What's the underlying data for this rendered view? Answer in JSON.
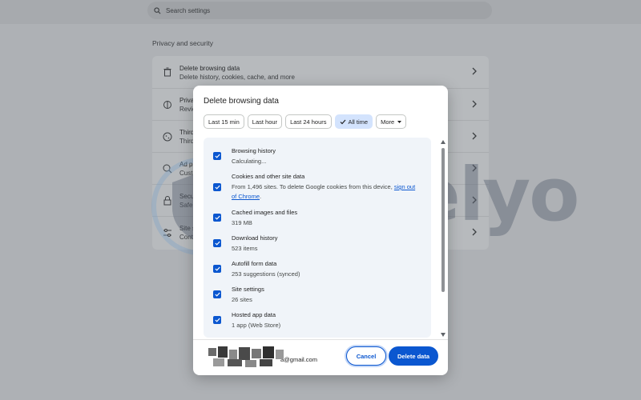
{
  "background": {
    "search_placeholder": "Search settings",
    "section_title": "Privacy and security",
    "rows": [
      {
        "title": "Delete browsing data",
        "subtitle": "Delete history, cookies, cache, and more",
        "icon": "trash-icon"
      },
      {
        "title": "Priva",
        "subtitle": "Revie",
        "icon": "privacy-guide-icon"
      },
      {
        "title": "Third",
        "subtitle": "Third",
        "icon": "cookie-icon"
      },
      {
        "title": "Ad p",
        "subtitle": "Custo",
        "icon": "ad-privacy-icon"
      },
      {
        "title": "Secu",
        "subtitle": "Safe",
        "icon": "lock-icon"
      },
      {
        "title": "Site s",
        "subtitle": "Cont",
        "icon": "tune-icon"
      }
    ]
  },
  "watermark": {
    "text": "Safelyo"
  },
  "dialog": {
    "title": "Delete browsing data",
    "time_ranges": [
      {
        "label": "Last 15 min",
        "selected": false
      },
      {
        "label": "Last hour",
        "selected": false
      },
      {
        "label": "Last 24 hours",
        "selected": false
      },
      {
        "label": "All time",
        "selected": true
      },
      {
        "label": "More",
        "selected": false
      }
    ],
    "items": [
      {
        "label": "Browsing history",
        "detail": "Calculating...",
        "checked": true
      },
      {
        "label": "Cookies and other site data",
        "detail": "From 1,496 sites. To delete Google cookies from this device, ",
        "link": "sign out of Chrome",
        "detail_end": ".",
        "checked": true
      },
      {
        "label": "Cached images and files",
        "detail": "319 MB",
        "checked": true
      },
      {
        "label": "Download history",
        "detail": "523 items",
        "checked": true
      },
      {
        "label": "Autofill form data",
        "detail": "253 suggestions (synced)",
        "checked": true
      },
      {
        "label": "Site settings",
        "detail": "26 sites",
        "checked": true
      },
      {
        "label": "Hosted app data",
        "detail": "1 app (Web Store)",
        "checked": true
      }
    ],
    "account_email": "a@gmail.com",
    "cancel_label": "Cancel",
    "delete_label": "Delete data"
  },
  "colors": {
    "accent": "#0b57d0",
    "selected_chip": "#d3e3fd",
    "list_bg": "#f0f4f9"
  }
}
